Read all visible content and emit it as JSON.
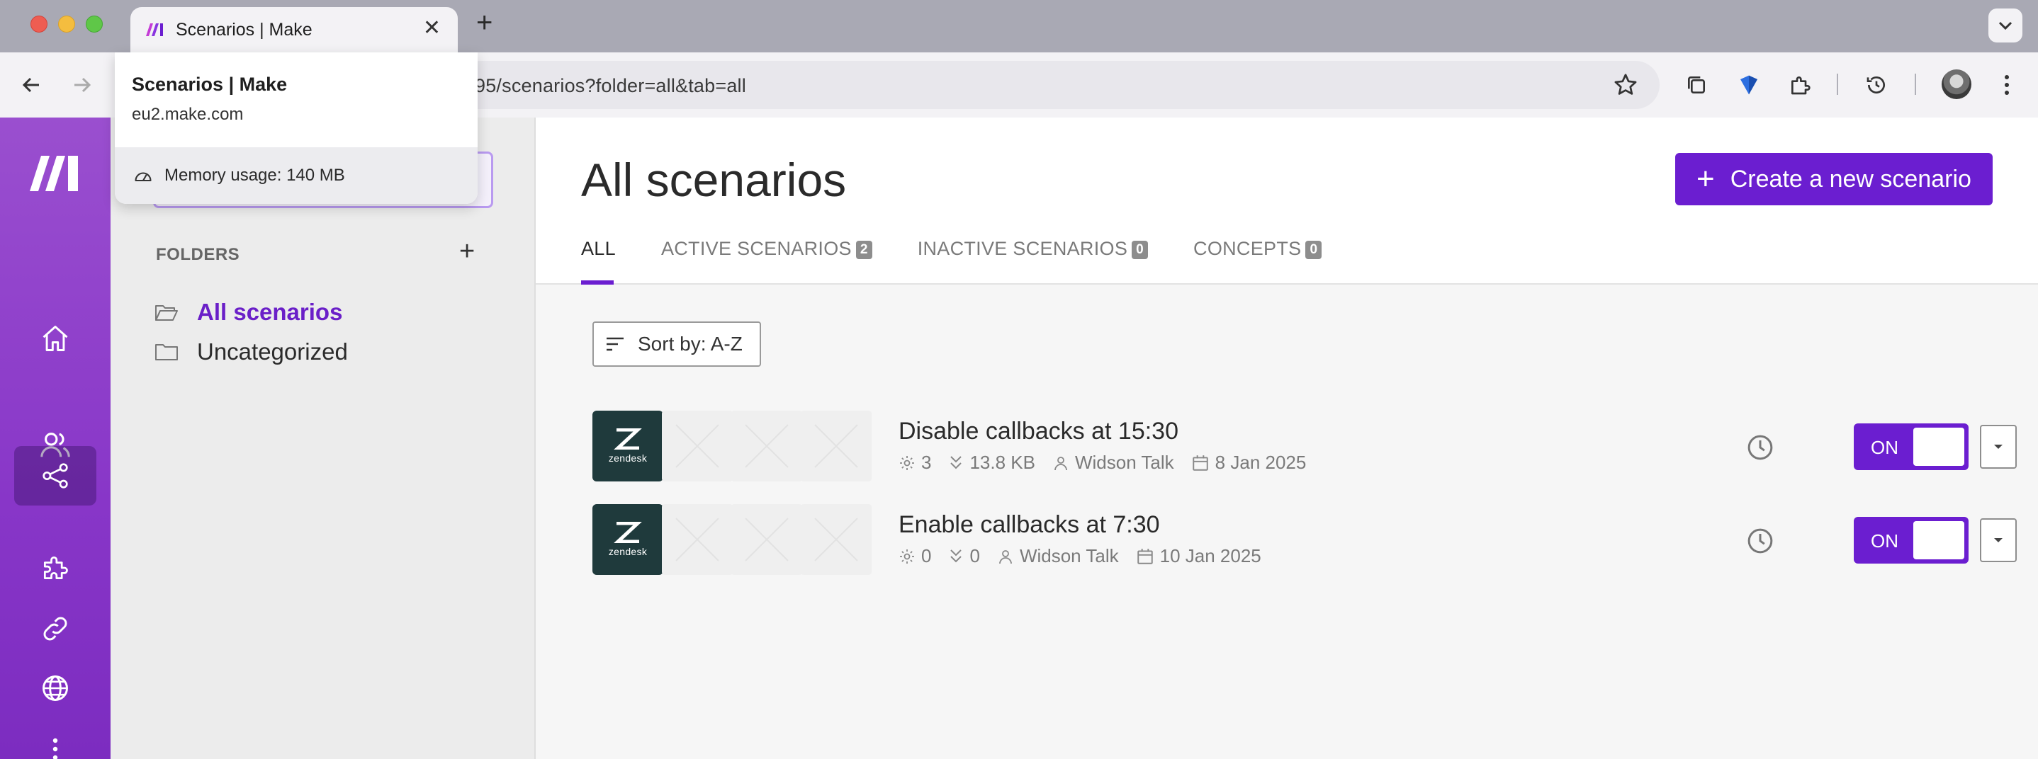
{
  "browser": {
    "tab_title": "Scenarios | Make",
    "url": "95/scenarios?folder=all&tab=all",
    "hovercard": {
      "title": "Scenarios | Make",
      "domain": "eu2.make.com",
      "memory": "Memory usage: 140 MB"
    }
  },
  "rail": {
    "items": [
      "home-icon",
      "team-icon",
      "scenarios-icon",
      "apps-icon",
      "connections-icon",
      "webhooks-icon",
      "more-icon"
    ],
    "active": "scenarios-icon"
  },
  "folders": {
    "heading": "FOLDERS",
    "items": [
      {
        "label": "All scenarios",
        "active": true
      },
      {
        "label": "Uncategorized",
        "active": false
      }
    ]
  },
  "main": {
    "title": "All scenarios",
    "create_label": "Create a new scenario",
    "tabs": [
      {
        "label": "ALL",
        "count": null
      },
      {
        "label": "ACTIVE SCENARIOS",
        "count": "2"
      },
      {
        "label": "INACTIVE SCENARIOS",
        "count": "0"
      },
      {
        "label": "CONCEPTS",
        "count": "0"
      }
    ],
    "sort_label": "Sort by: A-Z"
  },
  "scenarios": [
    {
      "name": "Disable callbacks at 15:30",
      "operations": "3",
      "data_transfer": "13.8 KB",
      "owner": "Widson Talk",
      "date": "8 Jan 2025",
      "status": "ON",
      "app": "zendesk"
    },
    {
      "name": "Enable callbacks at 7:30",
      "operations": "0",
      "data_transfer": "0",
      "owner": "Widson Talk",
      "date": "10 Jan 2025",
      "status": "ON",
      "app": "zendesk"
    }
  ],
  "colors": {
    "brand": "#6b1ed0",
    "rail": "#8836c8",
    "zendesk": "#1f3a3c"
  }
}
